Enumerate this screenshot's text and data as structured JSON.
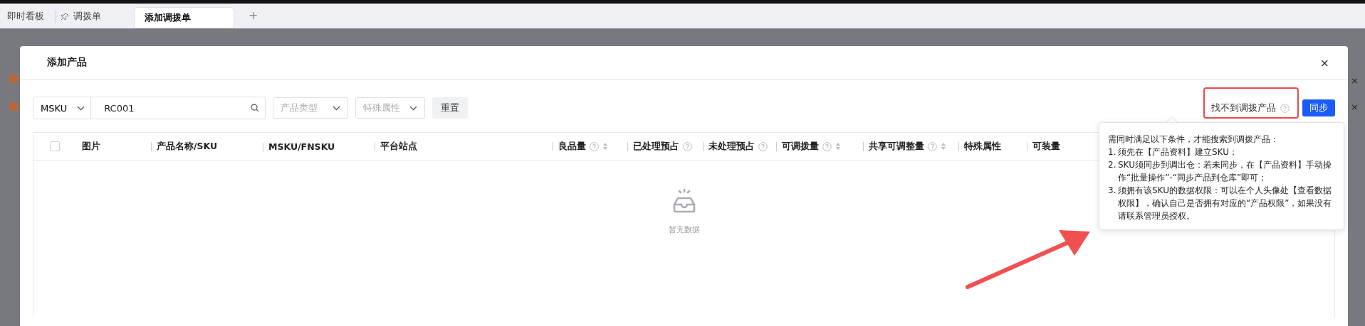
{
  "tabs": [
    {
      "label": "即时看板",
      "selected": false,
      "pinned": false
    },
    {
      "label": "调拨单",
      "selected": false,
      "pinned": true
    },
    {
      "label": "添加调拨单",
      "selected": true,
      "pinned": false
    }
  ],
  "new_tab": "+",
  "background_close_marks": [
    "×",
    "×"
  ],
  "dialog": {
    "title": "添加产品",
    "close": "×",
    "filters": {
      "field_select": "MSKU",
      "search_value": "RC001",
      "product_type_placeholder": "产品类型",
      "special_attr_placeholder": "特殊属性",
      "reset": "重置"
    },
    "missing_link": "找不到调拨产品",
    "sync": "同步",
    "table": {
      "columns": [
        {
          "label": "图片",
          "help": false,
          "sortable": false
        },
        {
          "label": "产品名称/SKU",
          "help": false,
          "sortable": false
        },
        {
          "label": "MSKU/FNSKU",
          "help": false,
          "sortable": false
        },
        {
          "label": "平台站点",
          "help": false,
          "sortable": false
        },
        {
          "label": "良品量",
          "help": true,
          "sortable": true
        },
        {
          "label": "已处理预占",
          "help": true,
          "sortable": false
        },
        {
          "label": "未处理预占",
          "help": true,
          "sortable": false
        },
        {
          "label": "可调拨量",
          "help": true,
          "sortable": true
        },
        {
          "label": "共享可调整量",
          "help": true,
          "sortable": true
        },
        {
          "label": "特殊属性",
          "help": false,
          "sortable": false
        },
        {
          "label": "可装量",
          "help": false,
          "sortable": false
        }
      ],
      "select_all_checked": false,
      "empty_text": "暂无数据"
    },
    "tooltip": {
      "intro": "需同时满足以下条件，才能搜索到调拨产品：",
      "items": [
        {
          "number": "1.",
          "text": "须先在【产品资料】建立SKU；"
        },
        {
          "number": "2.",
          "text": "SKU须同步到调出仓：若未同步，在【产品资料】手动操作“批量操作”-“同步产品到仓库”即可；"
        },
        {
          "number": "3.",
          "text": "须拥有该SKU的数据权限：可以在个人头像处【查看数据权限】，确认自己是否拥有对应的“产品权限”，如果没有请联系管理员授权。"
        }
      ]
    }
  }
}
